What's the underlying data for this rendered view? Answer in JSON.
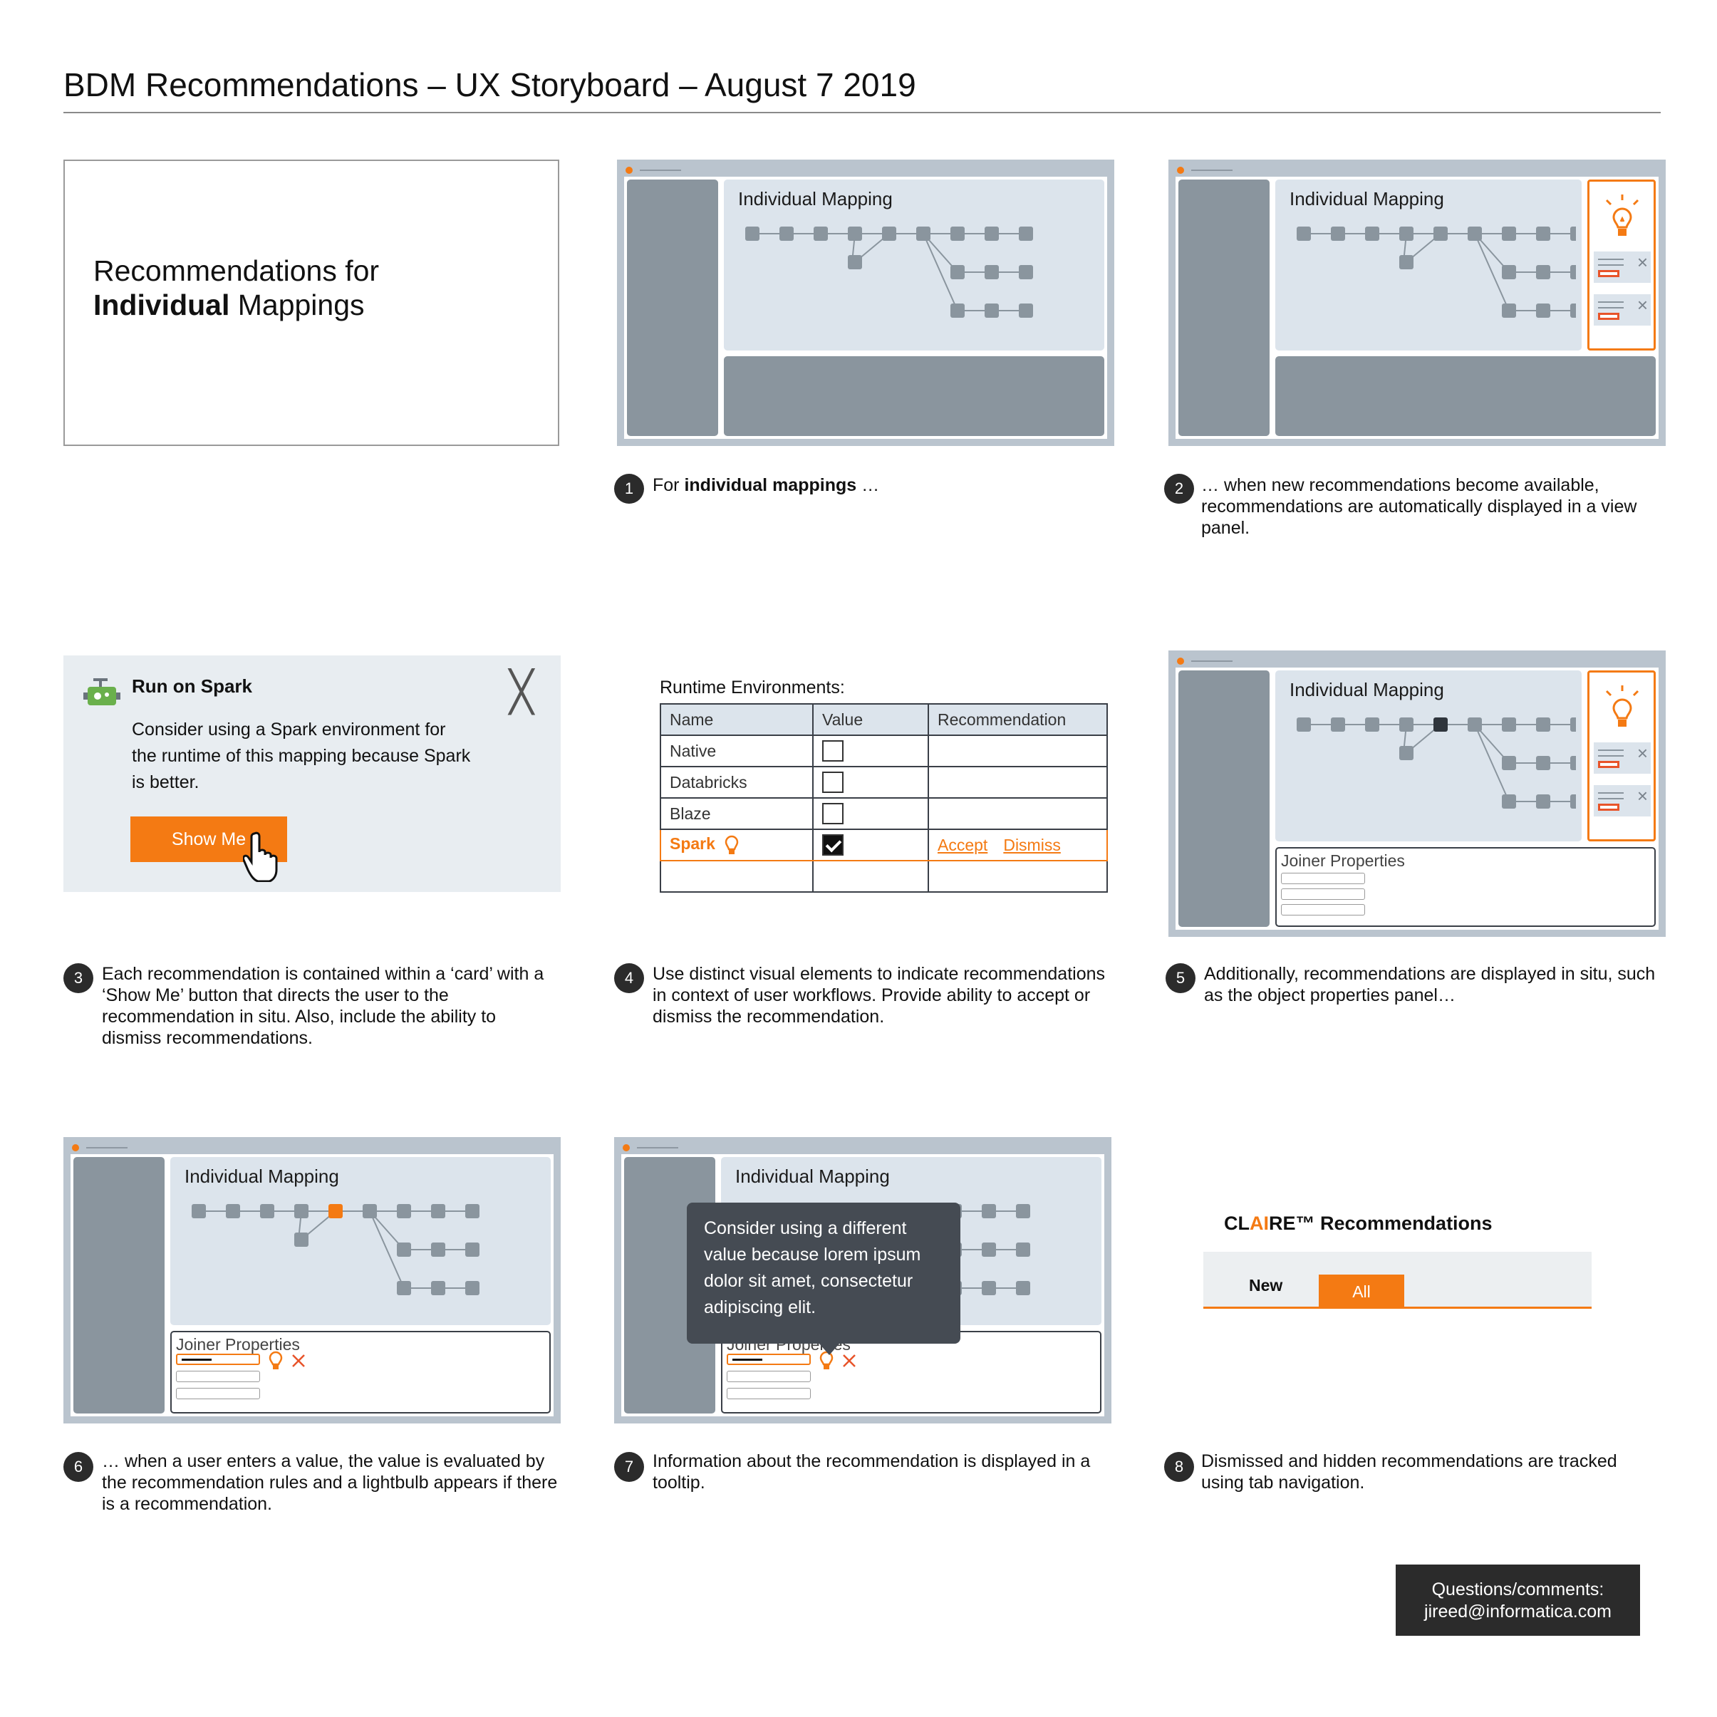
{
  "title": "BDM Recommendations – UX Storyboard – August 7 2019",
  "intro": {
    "line1": "Recommendations for",
    "bold": "Individual",
    "rest": " Mappings"
  },
  "map_title": "Individual Mapping",
  "joiner_title": "Joiner Properties",
  "steps": [
    {
      "num": "1",
      "pre": "For ",
      "bold": "individual mappings",
      "post": " …"
    },
    {
      "num": "2",
      "text": "… when new recommendations become available, recommendations are automatically displayed in a view panel."
    },
    {
      "num": "3",
      "text": "Each recommendation is contained within a ‘card’ with a ‘Show Me’ button that directs the user to the recommendation in situ. Also, include the ability to dismiss recommendations."
    },
    {
      "num": "4",
      "text": "Use distinct visual elements to indicate recommendations in context of user workflows. Provide ability to accept or dismiss the recommendation."
    },
    {
      "num": "5",
      "text": "Additionally, recommendations are displayed in situ, such as the object properties panel…"
    },
    {
      "num": "6",
      "text": "… when a user enters a value, the value is evaluated by the recommendation rules and a lightbulb appears if there is a recommendation."
    },
    {
      "num": "7",
      "text": "Information about the recommendation is displayed in a tooltip."
    },
    {
      "num": "8",
      "text": "Dismissed and hidden recommendations are tracked using tab navigation."
    }
  ],
  "card": {
    "title": "Run on Spark",
    "body": "Consider using a Spark environment for the runtime of this mapping because Spark is better.",
    "button": "Show Me"
  },
  "runtime": {
    "label": "Runtime Environments:",
    "headers": [
      "Name",
      "Value",
      "Recommendation"
    ],
    "rows": [
      {
        "name": "Native",
        "checked": false
      },
      {
        "name": "Databricks",
        "checked": false
      },
      {
        "name": "Blaze",
        "checked": false
      },
      {
        "name": "Spark",
        "checked": true
      }
    ],
    "accept": "Accept",
    "dismiss": "Dismiss"
  },
  "tooltip": "Consider using a different value because lorem ipsum dolor sit amet, consectetur adipiscing elit.",
  "claire": {
    "pre": "CL",
    "ai": "AI",
    "post": "RE™ Recommendations",
    "tab_new": "New",
    "tab_all": "All"
  },
  "contact": {
    "line1": "Questions/comments:",
    "line2": "jireed@informatica.com"
  },
  "colors": {
    "accent": "#f47a13",
    "frame": "#bac4ce",
    "panel": "#dce4ec",
    "dark": "#8a959e"
  }
}
